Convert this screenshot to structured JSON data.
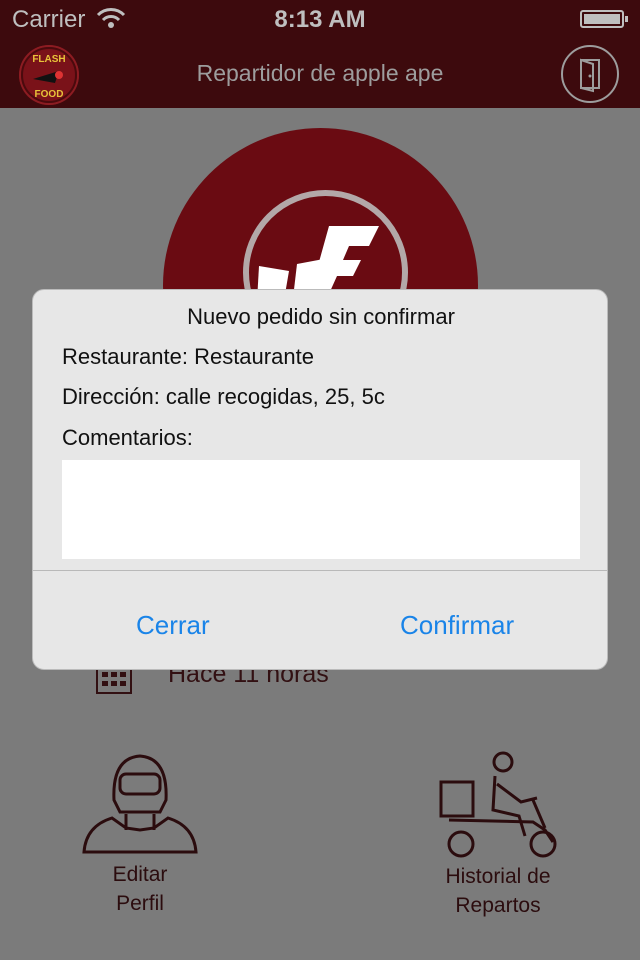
{
  "status_bar": {
    "carrier": "Carrier",
    "time": "8:13 AM"
  },
  "nav": {
    "title": "Repartidor de apple ape",
    "logo_text": "FLASH FOOD",
    "exit_icon": "door-exit-icon"
  },
  "background": {
    "time_ago": "Hace 11 horas"
  },
  "bottom_menu": {
    "edit_profile_line1": "Editar",
    "edit_profile_line2": "Perfil",
    "history_line1": "Historial de",
    "history_line2": "Repartos"
  },
  "alert": {
    "title": "Nuevo pedido sin confirmar",
    "restaurant": "Restaurante: Restaurante",
    "address": "Dirección: calle recogidas, 25, 5c",
    "comments_label": "Comentarios:",
    "comments_value": "",
    "close_label": "Cerrar",
    "confirm_label": "Confirmar"
  },
  "colors": {
    "brand": "#3d0a0d",
    "accent": "#6a0b12",
    "link_blue": "#1a84e8"
  }
}
